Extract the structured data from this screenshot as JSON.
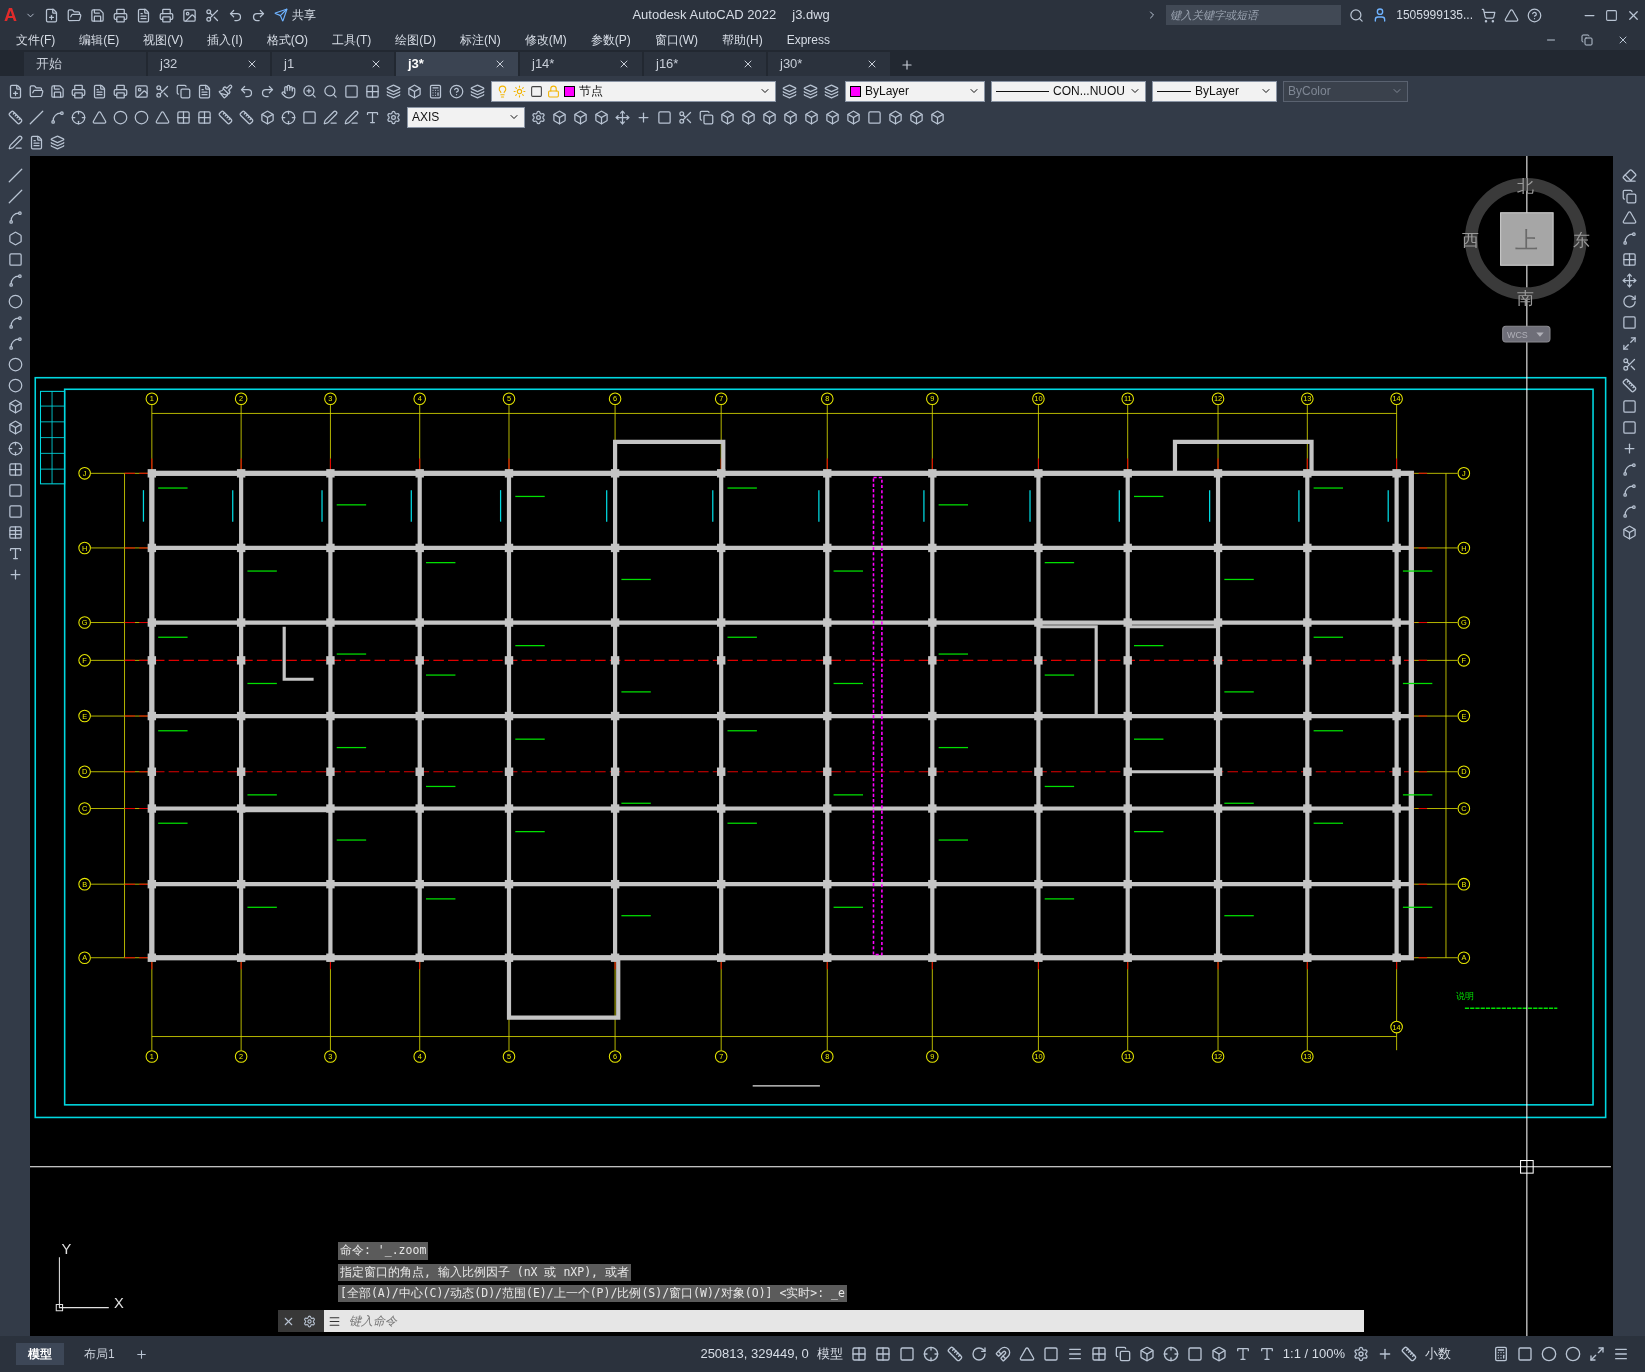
{
  "title_bar": {
    "logo": "A",
    "share": "共享",
    "app_title": "Autodesk AutoCAD 2022",
    "file_name": "j3.dwg",
    "search": {
      "placeholder": "键入关键字或短语"
    },
    "user": "1505999135..."
  },
  "menu": [
    "文件(F)",
    "编辑(E)",
    "视图(V)",
    "插入(I)",
    "格式(O)",
    "工具(T)",
    "绘图(D)",
    "标注(N)",
    "修改(M)",
    "参数(P)",
    "窗口(W)",
    "帮助(H)",
    "Express"
  ],
  "tabs": [
    {
      "label": "开始",
      "selected": false,
      "closable": false
    },
    {
      "label": "j32",
      "selected": false,
      "closable": true
    },
    {
      "label": "j1",
      "selected": false,
      "closable": true
    },
    {
      "label": "j3*",
      "selected": true,
      "closable": true
    },
    {
      "label": "j14*",
      "selected": false,
      "closable": true
    },
    {
      "label": "j16*",
      "selected": false,
      "closable": true
    },
    {
      "label": "j30*",
      "selected": false,
      "closable": true
    }
  ],
  "properties": {
    "layer": "节点",
    "color_setting": "ByLayer",
    "linetype": "CON...NUOU",
    "lineweight": "ByLayer",
    "plot_style": {
      "value": "ByColor",
      "disabled": true
    },
    "dim_style": "AXIS"
  },
  "viewcube": {
    "north": "北",
    "south": "南",
    "west": "西",
    "east": "东",
    "face": "上",
    "ucs_menu": "WCS"
  },
  "drawing": {
    "top_axes": [
      "1",
      "2",
      "3",
      "4",
      "5",
      "6",
      "7",
      "8",
      "9",
      "10",
      "11",
      "12",
      "13",
      "14"
    ],
    "bottom_axes": [
      "1",
      "2",
      "3",
      "4",
      "5",
      "6",
      "7",
      "8",
      "9",
      "10",
      "11",
      "12",
      "13"
    ],
    "extra_bottom_axis": "14",
    "left_axes": [
      "J",
      "H",
      "G",
      "F",
      "E",
      "D",
      "C",
      "B",
      "A"
    ],
    "right_axes": [
      "J",
      "H",
      "G",
      "F",
      "E",
      "D",
      "C",
      "B",
      "A"
    ],
    "note_title": "说明"
  },
  "ucs_icon": {
    "x": "X",
    "y": "Y"
  },
  "command": {
    "history": [
      "命令: '_.zoom",
      "指定窗口的角点, 输入比例因子 (nX 或 nXP), 或者",
      "[全部(A)/中心(C)/动态(D)/范围(E)/上一个(P)/比例(S)/窗口(W)/对象(O)] <实时>: _e"
    ],
    "placeholder": "键入命令"
  },
  "layout_tabs": [
    {
      "label": "模型",
      "selected": true
    },
    {
      "label": "布局1",
      "selected": false
    }
  ],
  "status_bar": {
    "coordinates": "250813, 329449, 0",
    "space": "模型",
    "scale": "1:1 / 100%",
    "units": "小数"
  }
}
